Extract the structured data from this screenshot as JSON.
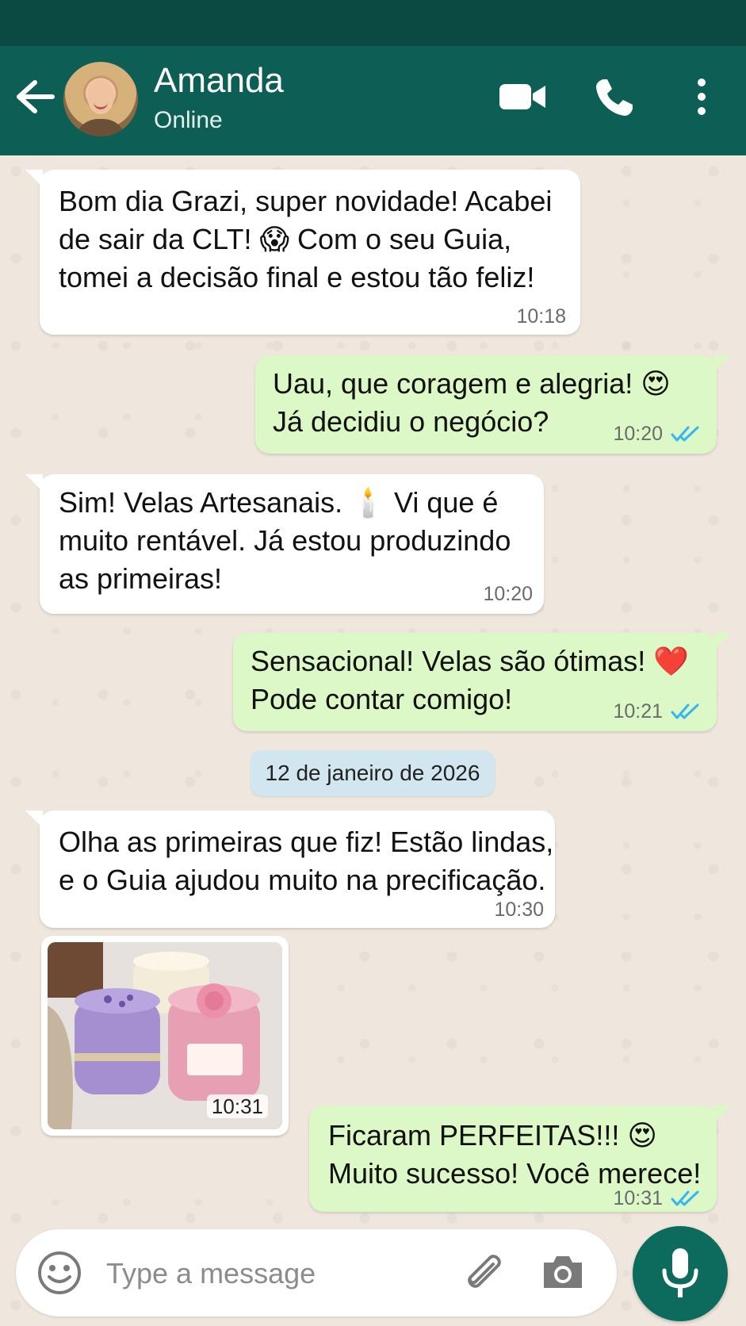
{
  "header": {
    "contact_name": "Amanda",
    "status": "Online"
  },
  "messages": [
    {
      "side": "incoming",
      "text": "Bom dia Grazi, super novidade! Acabei\nde sair da CLT! 😱 Com o seu Guia,\ntomei a decisão final e estou tão feliz!",
      "time": "10:18"
    },
    {
      "side": "outgoing",
      "text": "Uau, que coragem e alegria! 😍\nJá decidiu o negócio?",
      "time": "10:20",
      "read": true
    },
    {
      "side": "incoming",
      "text": "Sim! Velas Artesanais. 🕯️  Vi que é\nmuito rentável. Já estou produzindo\nas primeiras!",
      "time": "10:20"
    },
    {
      "side": "outgoing",
      "text": "Sensacional! Velas são ótimas! ❤️\nPode contar comigo!",
      "time": "10:21",
      "read": true
    },
    {
      "side": "incoming",
      "text": "Olha as primeiras que fiz! Estão lindas,\ne o Guia ajudou muito na precificação.",
      "time": "10:30"
    },
    {
      "side": "incoming",
      "type": "image",
      "time": "10:31"
    },
    {
      "side": "outgoing",
      "text": "Ficaram PERFEITAS!!! 😍\nMuito sucesso! Você merece!",
      "time": "10:31",
      "read": true
    }
  ],
  "date_separator": "12 de janeiro de 2026",
  "input": {
    "placeholder": "Type a message"
  },
  "icons": {
    "back": "arrow-left-icon",
    "video": "video-camera-icon",
    "call": "phone-icon",
    "menu": "more-vertical-icon",
    "emoji": "emoji-icon",
    "attach": "paperclip-icon",
    "camera": "camera-icon",
    "mic": "microphone-icon"
  },
  "colors": {
    "header": "#0d5e54",
    "outgoing_bubble": "#dcf8c6",
    "incoming_bubble": "#ffffff",
    "read_ticks": "#34b7f1",
    "mic_button": "#0d6b5e"
  }
}
